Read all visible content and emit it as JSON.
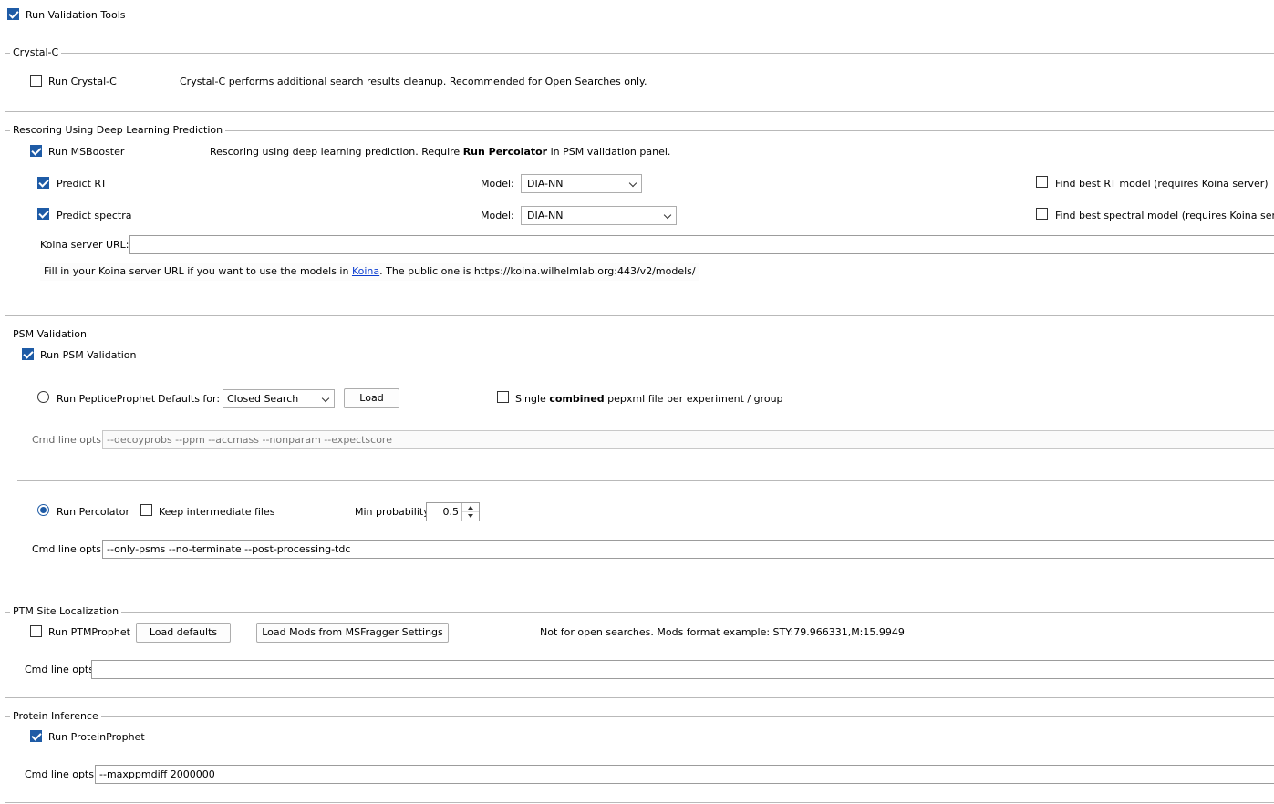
{
  "top": {
    "run_validation_tools": {
      "label": "Run Validation Tools",
      "checked": true
    }
  },
  "crystal_c": {
    "title": "Crystal-C",
    "run": {
      "label": "Run Crystal-C",
      "checked": false
    },
    "description": "Crystal-C performs additional search results cleanup. Recommended for Open Searches only."
  },
  "rescoring": {
    "title": "Rescoring Using Deep Learning Prediction",
    "run_msbooster": {
      "label": "Run MSBooster",
      "checked": true
    },
    "desc_prefix": "Rescoring using deep learning prediction. Require ",
    "desc_bold": "Run Percolator",
    "desc_suffix": " in PSM validation panel.",
    "predict_rt": {
      "label": "Predict RT",
      "checked": true
    },
    "rt_model_label": "Model:",
    "rt_model_value": "DIA-NN",
    "find_best_rt": {
      "label": "Find best RT model (requires Koina server)",
      "checked": false
    },
    "predict_spectra": {
      "label": "Predict spectra",
      "checked": true
    },
    "spectra_model_label": "Model:",
    "spectra_model_value": "DIA-NN",
    "find_best_spectral": {
      "label": "Find best spectral model (requires Koina server)",
      "checked": false
    },
    "koina_label": "Koina server URL:",
    "koina_value": "",
    "tip_prefix": "Fill in your Koina server URL if you want to use the models in ",
    "tip_link": "Koina",
    "tip_suffix": ". The public one is https://koina.wilhelmlab.org:443/v2/models/"
  },
  "psm": {
    "title": "PSM Validation",
    "run_psm": {
      "label": "Run PSM Validation",
      "checked": true
    },
    "peptideprophet": {
      "label": "Run PeptideProphet",
      "selected": false
    },
    "defaults_for_label": "Defaults for:",
    "defaults_for_value": "Closed Search",
    "load_button": "Load",
    "single_prefix": "Single ",
    "single_bold": "combined",
    "single_suffix": " pepxml file per experiment / group",
    "single_checked": false,
    "pp_cmd_label": "Cmd line opts:",
    "pp_cmd_value": "--decoyprobs --ppm --accmass --nonparam --expectscore",
    "percolator": {
      "label": "Run Percolator",
      "selected": true
    },
    "keep_intermediate": {
      "label": "Keep intermediate files",
      "checked": false
    },
    "min_prob_label": "Min probability",
    "min_prob_value": "0.5",
    "perc_cmd_label": "Cmd line opts:",
    "perc_cmd_value": "--only-psms --no-terminate --post-processing-tdc"
  },
  "ptm": {
    "title": "PTM Site Localization",
    "run": {
      "label": "Run PTMProphet",
      "checked": false
    },
    "load_defaults": "Load defaults",
    "load_mods": "Load Mods from MSFragger Settings",
    "note": "Not for open searches. Mods format example: STY:79.966331,M:15.9949",
    "cmd_label": "Cmd line opts",
    "cmd_value": ""
  },
  "protein": {
    "title": "Protein Inference",
    "run": {
      "label": "Run ProteinProphet",
      "checked": true
    },
    "cmd_label": "Cmd line opts:",
    "cmd_value": "--maxppmdiff 2000000"
  }
}
